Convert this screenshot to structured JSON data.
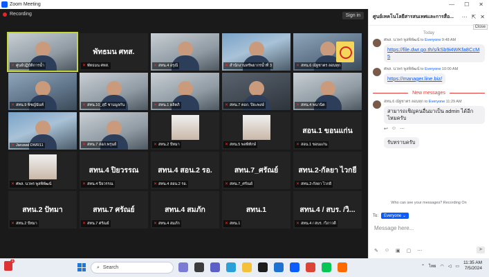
{
  "window": {
    "title": "Zoom Meeting"
  },
  "meeting": {
    "recording_label": "Recording",
    "sign_in_label": "Sign in",
    "tiles": [
      {
        "label": "ศูนย์ปฏิบัติการน้ำ",
        "big": "",
        "kind": "video",
        "style": "v2",
        "active": true
      },
      {
        "label": "พัทธมน ศทส.",
        "big": "พัทธมน ศทส.",
        "kind": "name"
      },
      {
        "label": "สทน.4 อรุณี",
        "big": "",
        "kind": "video",
        "style": "v2"
      },
      {
        "label": "สำนักงานทรัพยากรน้ำที่ 3",
        "big": "",
        "kind": "video",
        "style": "v4"
      },
      {
        "label": "สทน.6 ณัฐชาตร ลอนทุก",
        "big": "",
        "kind": "video",
        "style": "v3",
        "poster": true
      },
      {
        "label": "สทน.9 พิชญ์นันท์",
        "big": "",
        "kind": "video",
        "style": "v3"
      },
      {
        "label": "สทน.10_สุธี ชามมูลกัน",
        "big": "",
        "kind": "video",
        "style": "v2"
      },
      {
        "label": "สทน.1 ผลิตภิ",
        "big": "",
        "kind": "video",
        "style": "v2"
      },
      {
        "label": "สทน.7 คอก. ปิยะพงษ์",
        "big": "",
        "kind": "video",
        "style": "v5"
      },
      {
        "label": "สทน.4 พนานิต",
        "big": "",
        "kind": "video",
        "style": "v2"
      },
      {
        "label": "Jaruwat DWR11",
        "big": "",
        "kind": "video",
        "style": "v4"
      },
      {
        "label": "สทน.7 สอภ.พรุนย์",
        "big": "",
        "kind": "video",
        "style": "v2"
      },
      {
        "label": "สทน.2 ปัทมา",
        "big": "",
        "kind": "pic"
      },
      {
        "label": "สทน.5 พลพิทักษ์",
        "big": "",
        "kind": "pic"
      },
      {
        "label": "สอน.1 ขอนแก่น",
        "big": "สอน.1 ขอนแก่น",
        "kind": "name"
      },
      {
        "label": "ศพล. นวพร พูลพิพัฒน์",
        "big": "",
        "kind": "pic"
      },
      {
        "label": "สทน.4 ปิยวรรณ",
        "big": "สทน.4 ปิยวรรณ",
        "kind": "name"
      },
      {
        "label": "สทน.4 สอน.2 รอ.",
        "big": "สทน.4 สอน.2 รอ.",
        "kind": "name"
      },
      {
        "label": "สทน.7_ศรัณย์",
        "big": "สทน.7_ศรัณย์",
        "kind": "name"
      },
      {
        "label": "สทน.2-กัลยา ไวกยี",
        "big": "สทน.2-กัลยา ไวกยี",
        "kind": "name"
      },
      {
        "label": "สทน.2 ปัทมา",
        "big": "สทน.2 ปัทมา",
        "kind": "name"
      },
      {
        "label": "สทน.7 ศรัณย์",
        "big": "สทน.7 ศรัณย์",
        "kind": "name"
      },
      {
        "label": "สทน.4 สมภัก",
        "big": "สทน.4 สมภัก",
        "kind": "name"
      },
      {
        "label": "สทน.1",
        "big": "สทน.1",
        "kind": "name"
      },
      {
        "label": "สทน.4 / สบร. /วิภาวดี",
        "big": "สทน.4 / สบร. /วิ...",
        "kind": "name"
      }
    ]
  },
  "chat": {
    "title": "ศูนย์เทคโนโลยีสารสนเทศและการสื่อ...",
    "close_tooltip": "Close",
    "day_label": "Today",
    "messages": [
      {
        "sender": "ศพล. นวพร พูลพิพัฒน์",
        "to_label": "to",
        "to": "Everyone",
        "time": "9:48 AM",
        "text": "https://file.dwr.go.th/s/kSb9i4WKfa8CcM5",
        "link": true
      },
      {
        "sender": "ศพล. นวพร พูลพิพัฒน์",
        "to_label": "to",
        "to": "Everyone",
        "time": "10:00 AM",
        "text": "https://manager.line.biz/",
        "link": true
      }
    ],
    "new_messages_label": "New messages",
    "new_messages": [
      {
        "sender": "สทน.6 ณัฐชาตร ลอนทุก",
        "to_label": "to",
        "to": "Everyone",
        "time": "11:29 AM",
        "text": "สามารถเชิญคนอื่นมาเป็น admin ได้อีกไหมครับ"
      },
      {
        "sender": "",
        "to_label": "",
        "to": "",
        "time": "",
        "text": "รับทราบครับ"
      }
    ],
    "privacy_text": "Who can see your messages? Recording On",
    "to_prefix": "To:",
    "to_value": "Everyone",
    "compose_placeholder": "Message here..."
  },
  "taskbar": {
    "search_placeholder": "Search",
    "language": "ไทย",
    "time": "11:35 AM",
    "date": "7/5/2024"
  },
  "colors": {
    "zoom_blue": "#0b5cff",
    "recording_red": "#e02828",
    "active_speaker": "#c6d839",
    "new_messages_red": "#e53935"
  }
}
